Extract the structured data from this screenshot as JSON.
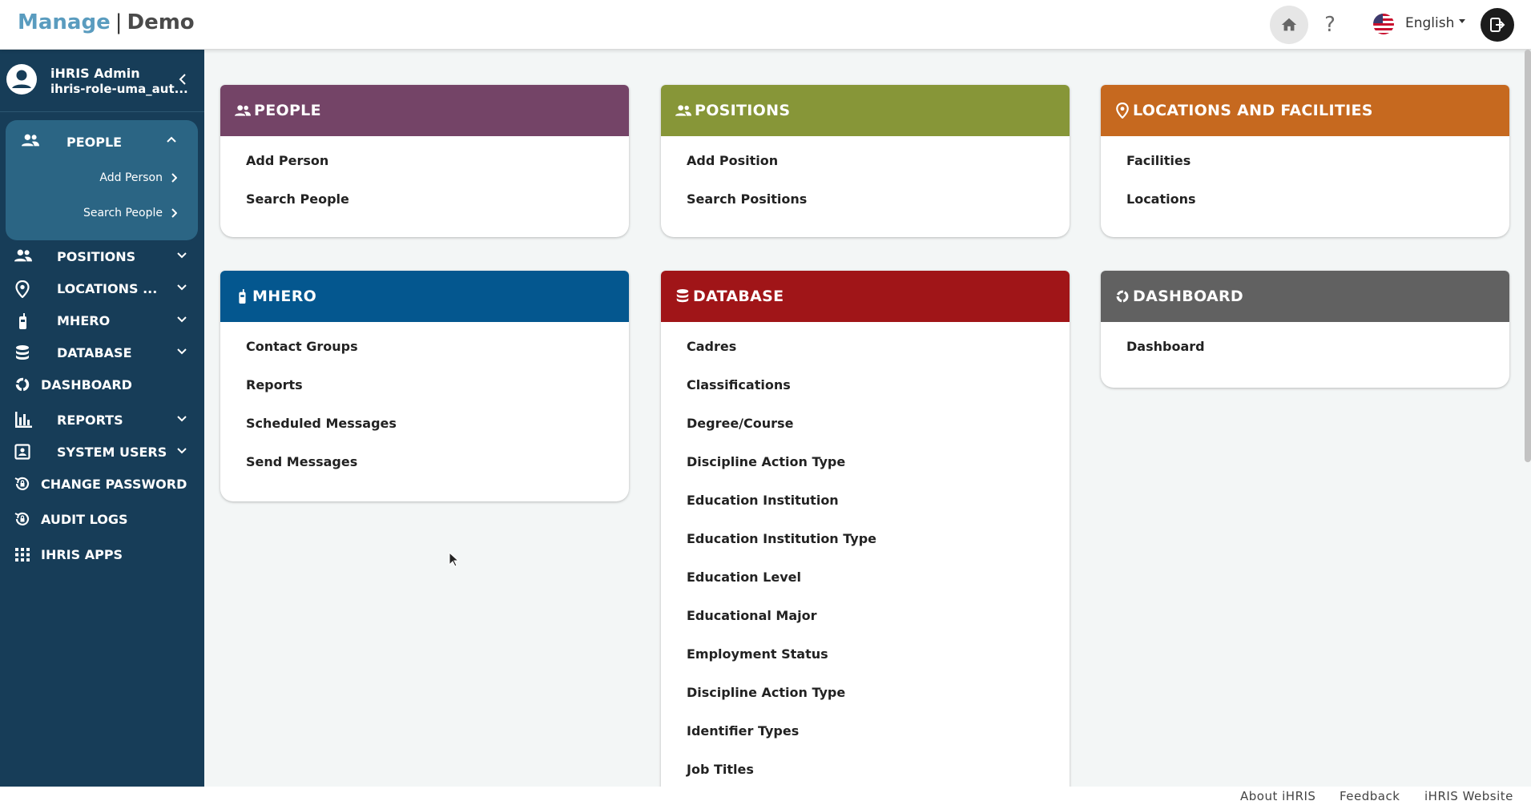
{
  "header": {
    "brand_primary": "Manage",
    "brand_separator": "|",
    "brand_secondary": "Demo",
    "help_label": "?",
    "language": "English"
  },
  "sidebar": {
    "user_name": "iHRIS Admin",
    "user_role": "ihris-role-uma_aut...",
    "people": {
      "label": "PEOPLE",
      "items": [
        "Add Person",
        "Search People"
      ]
    },
    "items": [
      {
        "label": "POSITIONS",
        "icon": "people-icon"
      },
      {
        "label": "LOCATIONS ...",
        "icon": "location-pin-icon"
      },
      {
        "label": "MHERO",
        "icon": "mobile-icon"
      },
      {
        "label": "DATABASE",
        "icon": "database-icon"
      },
      {
        "label": "DASHBOARD",
        "icon": "dashboard-icon"
      },
      {
        "label": "REPORTS",
        "icon": "bar-chart-icon"
      },
      {
        "label": "SYSTEM USERS",
        "icon": "id-badge-icon"
      },
      {
        "label": "CHANGE PASSWORD",
        "icon": "lock-reset-icon"
      },
      {
        "label": "AUDIT LOGS",
        "icon": "history-lock-icon"
      },
      {
        "label": "IHRIS APPS",
        "icon": "apps-grid-icon"
      }
    ]
  },
  "cards": {
    "people": {
      "title": "PEOPLE",
      "color": "#744467",
      "links": [
        "Add Person",
        "Search People"
      ]
    },
    "positions": {
      "title": "POSITIONS",
      "color": "#879638",
      "links": [
        "Add Position",
        "Search Positions"
      ]
    },
    "locations": {
      "title": "LOCATIONS AND FACILITIES",
      "color": "#c6691f",
      "links": [
        "Facilities",
        "Locations"
      ]
    },
    "mhero": {
      "title": "MHERO",
      "color": "#04578f",
      "links": [
        "Contact Groups",
        "Reports",
        "Scheduled Messages",
        "Send Messages"
      ]
    },
    "database": {
      "title": "DATABASE",
      "color": "#a01518",
      "links": [
        "Cadres",
        "Classifications",
        "Degree/Course",
        "Discipline Action Type",
        "Education Institution",
        "Education Institution Type",
        "Education Level",
        "Educational Major",
        "Employment Status",
        "Discipline Action Type",
        "Identifier Types",
        "Job Titles"
      ]
    },
    "dashboard": {
      "title": "DASHBOARD",
      "color": "#616161",
      "links": [
        "Dashboard"
      ]
    }
  },
  "footer": {
    "about": "About iHRIS",
    "feedback": "Feedback",
    "website": "iHRIS Website"
  }
}
